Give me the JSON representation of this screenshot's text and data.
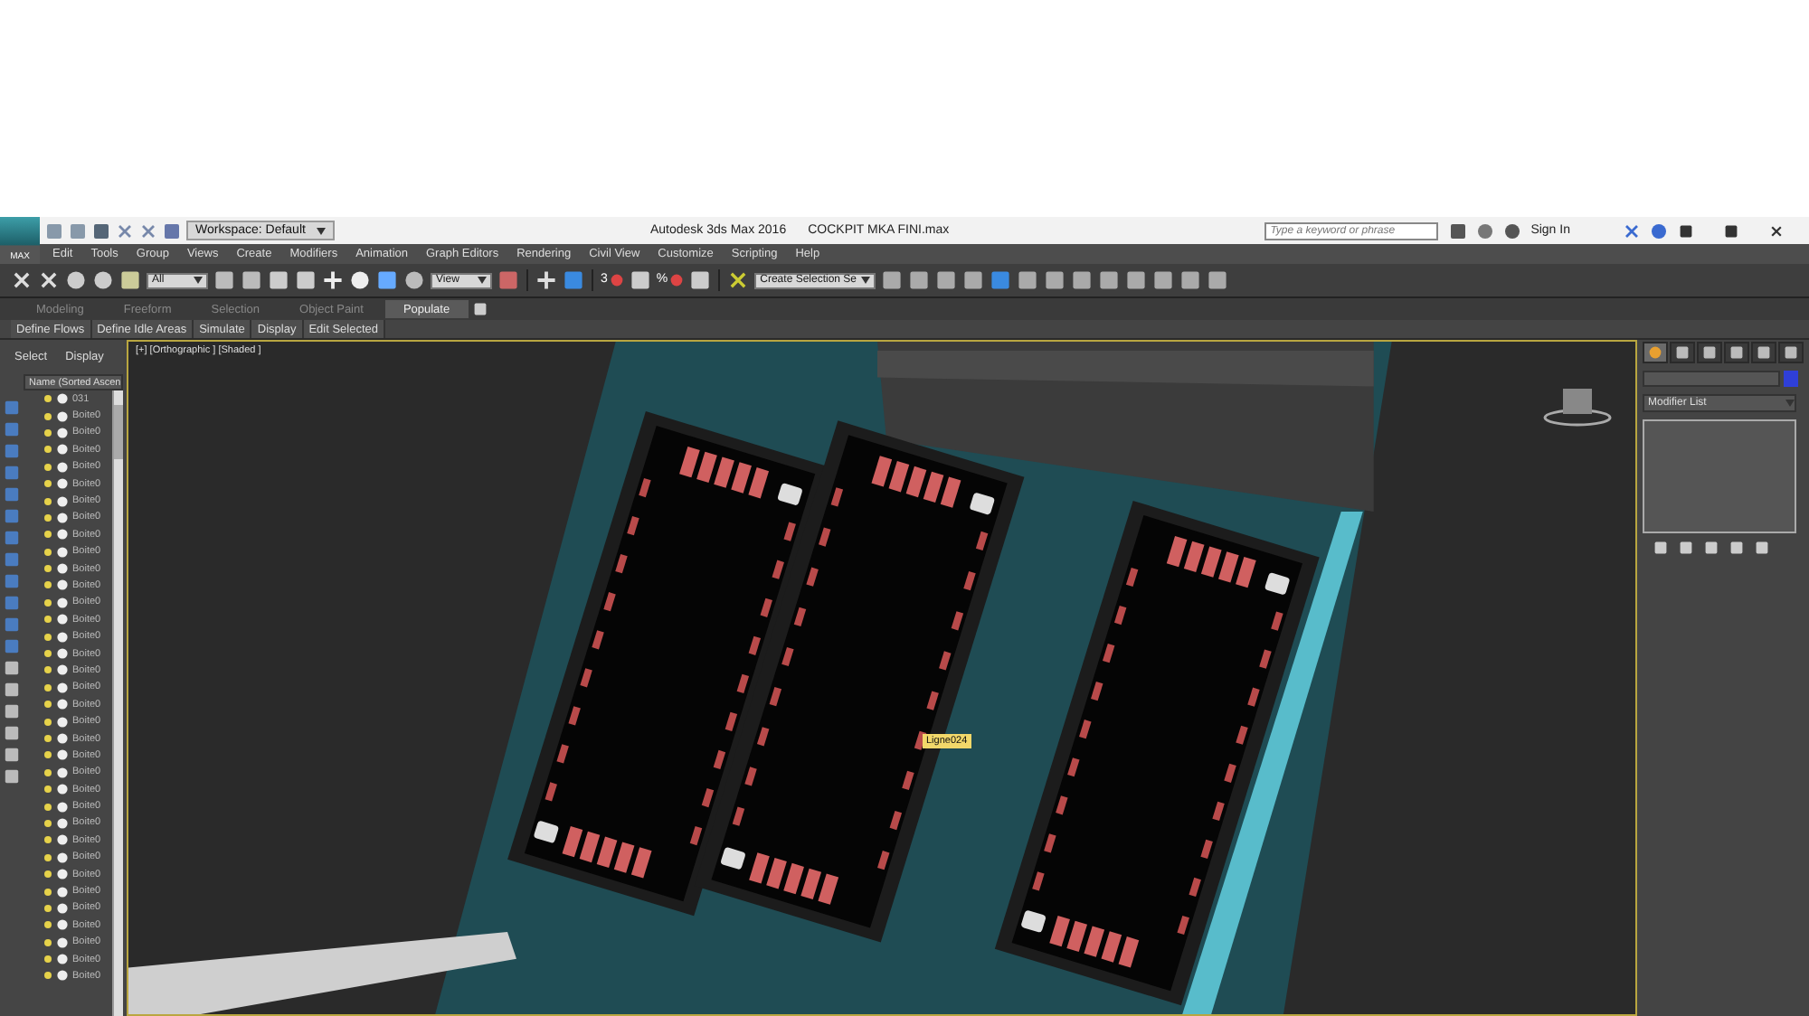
{
  "title_bar": {
    "app_button": "MAX",
    "workspace": "Workspace: Default",
    "app_title": "Autodesk 3ds Max 2016",
    "file_name": "COCKPIT MKA FINI.max",
    "search": {
      "placeholder": "Type a keyword or phrase"
    },
    "sign_in": "Sign In"
  },
  "menu_bar": [
    "Edit",
    "Tools",
    "Group",
    "Views",
    "Create",
    "Modifiers",
    "Animation",
    "Graph Editors",
    "Rendering",
    "Civil View",
    "Customize",
    "Scripting",
    "Help"
  ],
  "toolbar": {
    "selection_filter": "All",
    "reference_coord": "View",
    "angle_snap": "3",
    "percent_snap": "%",
    "named_selection": "Create Selection Se"
  },
  "ribbon": {
    "tabs": [
      {
        "label": "Modeling",
        "selected": false
      },
      {
        "label": "Freeform",
        "selected": false
      },
      {
        "label": "Selection",
        "selected": false
      },
      {
        "label": "Object Paint",
        "selected": false
      },
      {
        "label": "Populate",
        "selected": true
      }
    ],
    "commands": [
      "Define Flows",
      "Define Idle Areas",
      "Simulate",
      "Display",
      "Edit Selected"
    ]
  },
  "scene_explorer": {
    "tabs": [
      "Select",
      "Display"
    ],
    "column": "Name (Sorted Ascen",
    "items": [
      {
        "name": "031"
      },
      {
        "name": "Boite0"
      },
      {
        "name": "Boite0"
      },
      {
        "name": "Boite0"
      },
      {
        "name": "Boite0"
      },
      {
        "name": "Boite0"
      },
      {
        "name": "Boite0"
      },
      {
        "name": "Boite0"
      },
      {
        "name": "Boite0"
      },
      {
        "name": "Boite0"
      },
      {
        "name": "Boite0"
      },
      {
        "name": "Boite0"
      },
      {
        "name": "Boite0"
      },
      {
        "name": "Boite0"
      },
      {
        "name": "Boite0"
      },
      {
        "name": "Boite0"
      },
      {
        "name": "Boite0"
      },
      {
        "name": "Boite0"
      },
      {
        "name": "Boite0"
      },
      {
        "name": "Boite0"
      },
      {
        "name": "Boite0"
      },
      {
        "name": "Boite0"
      },
      {
        "name": "Boite0"
      },
      {
        "name": "Boite0"
      },
      {
        "name": "Boite0"
      },
      {
        "name": "Boite0"
      },
      {
        "name": "Boite0"
      },
      {
        "name": "Boite0"
      },
      {
        "name": "Boite0"
      },
      {
        "name": "Boite0"
      },
      {
        "name": "Boite0"
      },
      {
        "name": "Boite0"
      },
      {
        "name": "Boite0"
      },
      {
        "name": "Boite0"
      },
      {
        "name": "Boite0"
      }
    ]
  },
  "viewport": {
    "label": "[+] [Orthographic ] [Shaded ]",
    "tooltip": "Ligne024"
  },
  "command_panel": {
    "tabs": [
      {
        "selected": true
      },
      {
        "selected": false
      },
      {
        "selected": false
      },
      {
        "selected": false
      },
      {
        "selected": false
      },
      {
        "selected": false
      }
    ],
    "modifier_list": "Modifier List"
  }
}
